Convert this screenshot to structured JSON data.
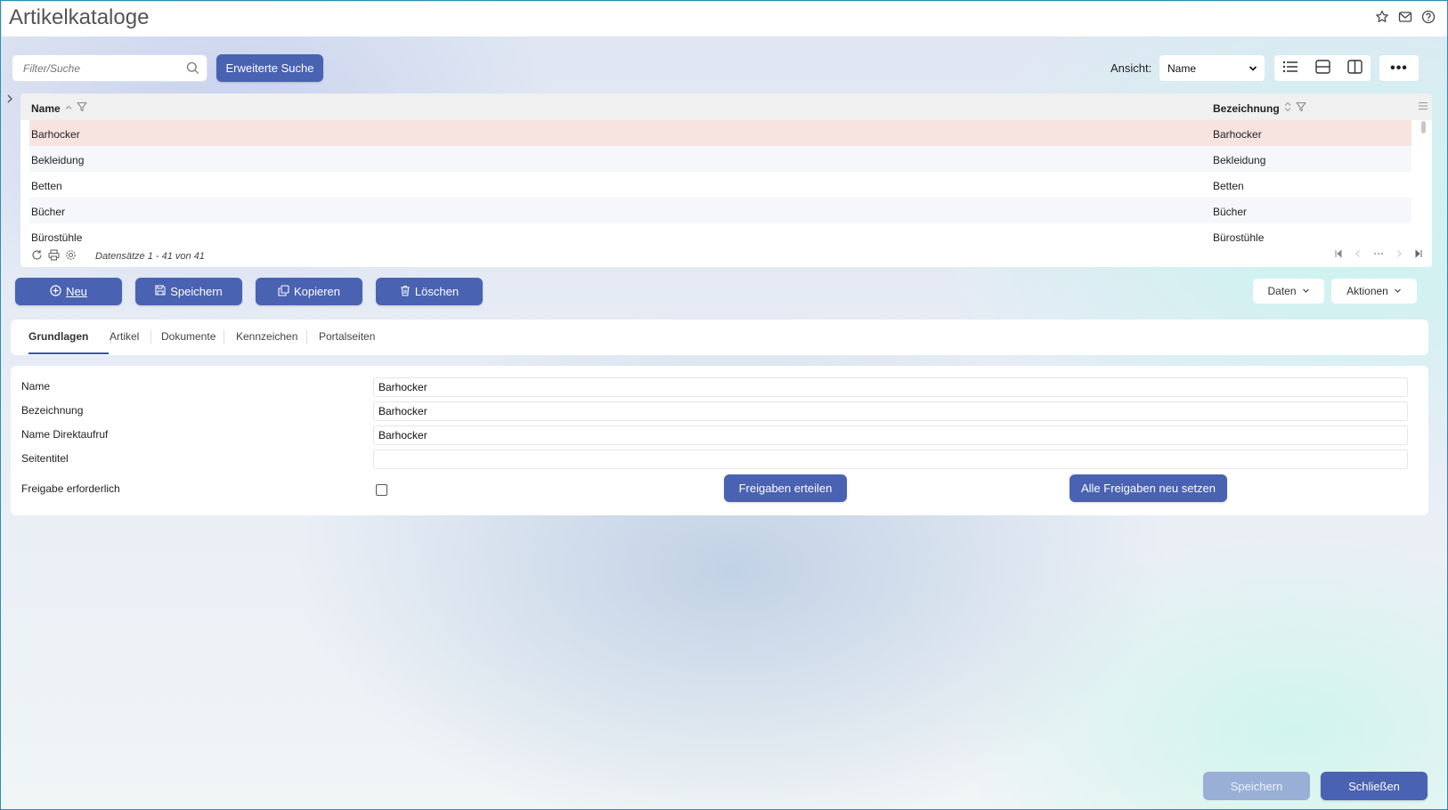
{
  "header": {
    "title": "Artikelkataloge",
    "icons": [
      "star-icon",
      "mail-icon",
      "help-icon"
    ]
  },
  "toolbar": {
    "search_placeholder": "Filter/Suche",
    "advanced_search_label": "Erweiterte Suche",
    "view_label": "Ansicht:",
    "view_value": "Name",
    "view_buttons": [
      "list-view-icon",
      "horizontal-split-icon",
      "vertical-split-icon"
    ],
    "more_label": "•••"
  },
  "grid": {
    "columns": [
      "Name",
      "Bezeichnung"
    ],
    "rows": [
      {
        "name": "Barhocker",
        "bezeichnung": "Barhocker"
      },
      {
        "name": "Bekleidung",
        "bezeichnung": "Bekleidung"
      },
      {
        "name": "Betten",
        "bezeichnung": "Betten"
      },
      {
        "name": "Bücher",
        "bezeichnung": "Bücher"
      },
      {
        "name": "Bürostühle",
        "bezeichnung": "Bürostühle"
      }
    ],
    "selected_row": 0,
    "footer_text": "Datensätze 1 - 41 von 41"
  },
  "actions": {
    "new_label": "Neu",
    "save_label": "Speichern",
    "copy_label": "Kopieren",
    "delete_label": "Löschen",
    "data_label": "Daten",
    "actions_label": "Aktionen"
  },
  "tabs": {
    "items": [
      "Grundlagen",
      "Artikel",
      "Dokumente",
      "Kennzeichen",
      "Portalseiten"
    ],
    "active": "Grundlagen"
  },
  "form": {
    "name_label": "Name",
    "name_value": "Barhocker",
    "bezeichnung_label": "Bezeichnung",
    "bezeichnung_value": "Barhocker",
    "direktaufruf_label": "Name Direktaufruf",
    "direktaufruf_value": "Barhocker",
    "seitentitel_label": "Seitentitel",
    "seitentitel_value": "",
    "freigabe_label": "Freigabe erforderlich",
    "freigabe_checked": false,
    "freigaben_erteilen_label": "Freigaben erteilen",
    "alle_freigaben_label": "Alle Freigaben neu setzen"
  },
  "footer": {
    "save_label": "Speichern",
    "close_label": "Schließen"
  },
  "colors": {
    "primary": "#4a62b2",
    "primary_disabled": "#9aafd6",
    "selected_row": "#f7e4e1",
    "tab_underline": "#3c57a8"
  }
}
